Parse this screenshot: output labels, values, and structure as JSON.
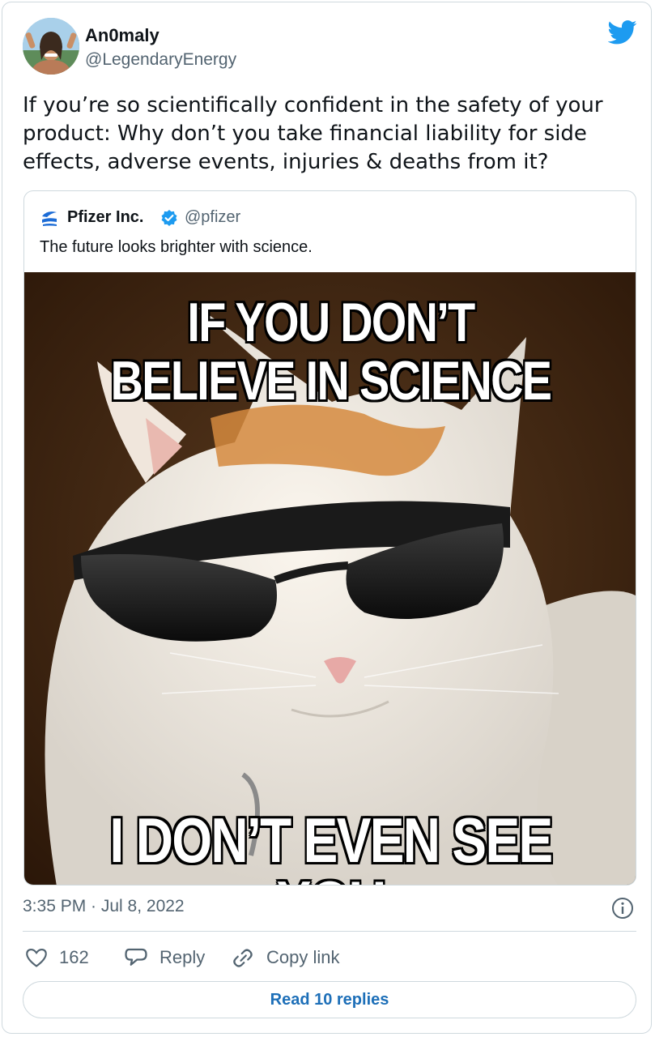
{
  "tweet": {
    "author_name": "An0maly",
    "author_handle": "@LegendaryEnergy",
    "text": "If you’re so scientifically confident in the safety of your product: Why don’t you take financial liability for side effects, adverse events, injuries & deaths from it?",
    "timestamp": "3:35 PM · Jul 8, 2022"
  },
  "quoted_tweet": {
    "author_name": "Pfizer Inc.",
    "author_handle": "@pfizer",
    "text": "The future looks brighter with science.",
    "meme": {
      "top_line_1": "IF YOU DON’T",
      "top_line_2": "BELIEVE IN SCIENCE",
      "bottom_line": "I DON’T EVEN SEE YOU"
    }
  },
  "actions": {
    "like_count": "162",
    "reply_label": "Reply",
    "copy_link_label": "Copy link",
    "read_replies_label": "Read 10 replies"
  },
  "icons": {
    "brand": "twitter-bird-icon",
    "verified": "verified-badge-icon",
    "info": "info-icon",
    "like": "heart-icon",
    "reply": "speech-bubble-icon",
    "copy_link": "link-icon"
  },
  "colors": {
    "twitter_blue": "#1d9bf0",
    "link_blue": "#1d6fb8",
    "muted": "#536471",
    "border": "#cfd9de"
  }
}
